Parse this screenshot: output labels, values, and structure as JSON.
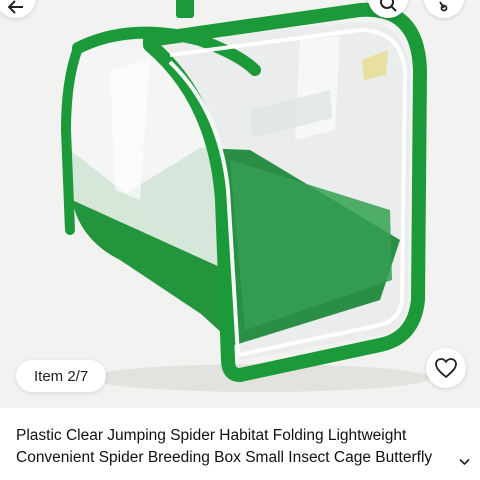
{
  "gallery": {
    "counter_label": "Item 2/7",
    "image_alt": "Green-trimmed clear plastic folding insect habitat with handle"
  },
  "top_bar": {
    "icons": [
      "back-icon",
      "search-icon",
      "share-icon"
    ]
  },
  "actions": {
    "favorite_icon": "heart-outline-icon"
  },
  "product": {
    "title": "Plastic Clear Jumping Spider Habitat Folding Lightweight Convenient Spider Breeding Box Small Insect Cage Butterfly"
  },
  "colors": {
    "trim_green": "#1c9a3a",
    "background": "#f2f2f0"
  }
}
